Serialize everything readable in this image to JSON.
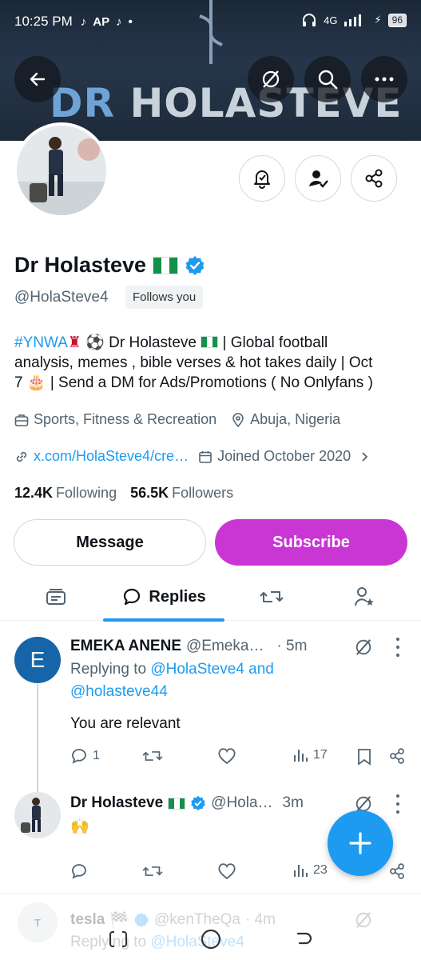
{
  "status_bar": {
    "time": "10:25 PM",
    "apps": [
      "tiktok-icon",
      "AP",
      "tiktok-icon",
      "•"
    ],
    "network": "4G",
    "battery": "96"
  },
  "banner": {
    "title_dr": "DR",
    "title_rest": "HOLASTEVE",
    "colors": {
      "bg": "#1b2838",
      "accent": "#6fa3d6"
    }
  },
  "header_buttons": [
    "back-arrow-icon",
    "grok-icon",
    "search-icon",
    "more-icon"
  ],
  "profile": {
    "display_name": "Dr Holasteve",
    "handle": "@HolaSteve4",
    "follows_you": "Follows you",
    "bio_tag": "#YNWA",
    "bio_line1_rest": "⚽ Dr Holasteve",
    "bio_line1_end": "| Global football",
    "bio_line2": "analysis, memes , bible verses & hot takes daily | Oct",
    "bio_line3_start": "7",
    "bio_line3_end": "| Send a DM for Ads/Promotions ( No Onlyfans )",
    "category": "Sports, Fitness & Recreation",
    "location": "Abuja, Nigeria",
    "website": "x.com/HolaSteve4/cre…",
    "joined": "Joined October 2020",
    "following_count": "12.4K",
    "following_label": "Following",
    "followers_count": "56.5K",
    "followers_label": "Followers"
  },
  "buttons": {
    "message": "Message",
    "subscribe": "Subscribe",
    "subscribe_color": "#c936d3"
  },
  "tabs": [
    {
      "icon": "highlights-icon",
      "label": ""
    },
    {
      "icon": "replies-icon",
      "label": "Replies",
      "active": true
    },
    {
      "icon": "reposts-icon",
      "label": ""
    },
    {
      "icon": "affiliates-icon",
      "label": ""
    }
  ],
  "tweets": [
    {
      "avatar_letter": "E",
      "name": "EMEKA ANENE",
      "handle": "@Emeka…",
      "time": "· 5m",
      "replying_prefix": "Replying to",
      "replying_user1": "@HolaSteve4 and",
      "replying_user2": "@holasteve44",
      "text": "You are relevant",
      "replies": "1",
      "retweets": "",
      "likes": "",
      "views": "17"
    },
    {
      "name": "Dr Holasteve",
      "handle": "@Hola…",
      "time": "3m",
      "text": "🙌",
      "replies": "",
      "retweets": "",
      "likes": "",
      "views": "23"
    },
    {
      "name": "tesla",
      "name_suffix": "🏁",
      "handle": "@kenTheQa",
      "time": "· 4m",
      "replying_prefix": "Replying to",
      "replying_user1": "@HolaSteve4"
    }
  ],
  "fab": {
    "icon": "plus-icon"
  },
  "nav": [
    "recents-icon",
    "home-icon",
    "back-icon"
  ]
}
